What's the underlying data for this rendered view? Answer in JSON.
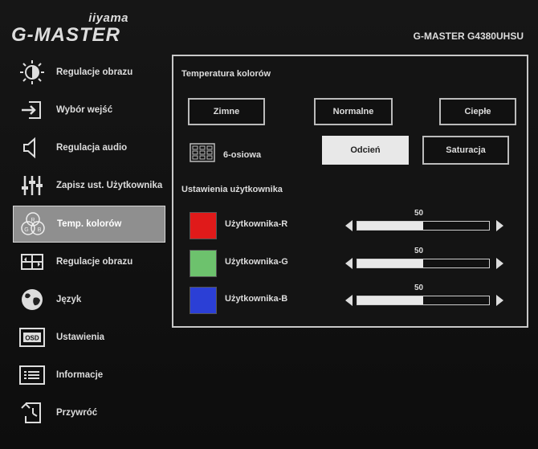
{
  "brand": {
    "sub": "iiyama",
    "main": "G-MASTER"
  },
  "model": "G-MASTER G4380UHSU",
  "sidebar": {
    "items": [
      {
        "label": "Regulacje obrazu"
      },
      {
        "label": "Wybór wejść"
      },
      {
        "label": "Regulacja audio"
      },
      {
        "label": "Zapisz ust. Użytkownika"
      },
      {
        "label": "Temp. kolorów"
      },
      {
        "label": "Regulacje obrazu"
      },
      {
        "label": "Język"
      },
      {
        "label": "Ustawienia"
      },
      {
        "label": "Informacje"
      },
      {
        "label": "Przywróć"
      }
    ],
    "active_index": 4
  },
  "panel": {
    "title": "Temperatura kolorów",
    "presets": [
      "Zimne",
      "Normalne",
      "Ciepłe"
    ],
    "axis_label": "6-osiowa",
    "axis_buttons": [
      "Odcień",
      "Saturacja"
    ],
    "axis_selected": "Odcień",
    "user_title": "Ustawienia użytkownika",
    "user_rows": [
      {
        "label": "Użytkownika-R",
        "value": "50",
        "level": 50,
        "color": "#e01a1a"
      },
      {
        "label": "Użytkownika-G",
        "value": "50",
        "level": 50,
        "color": "#6dc26d"
      },
      {
        "label": "Użytkownika-B",
        "value": "50",
        "level": 50,
        "color": "#2b3fd6"
      }
    ]
  },
  "icons": {
    "osd_text": "OSD",
    "rgb_letters": [
      "R",
      "G",
      "B"
    ]
  }
}
